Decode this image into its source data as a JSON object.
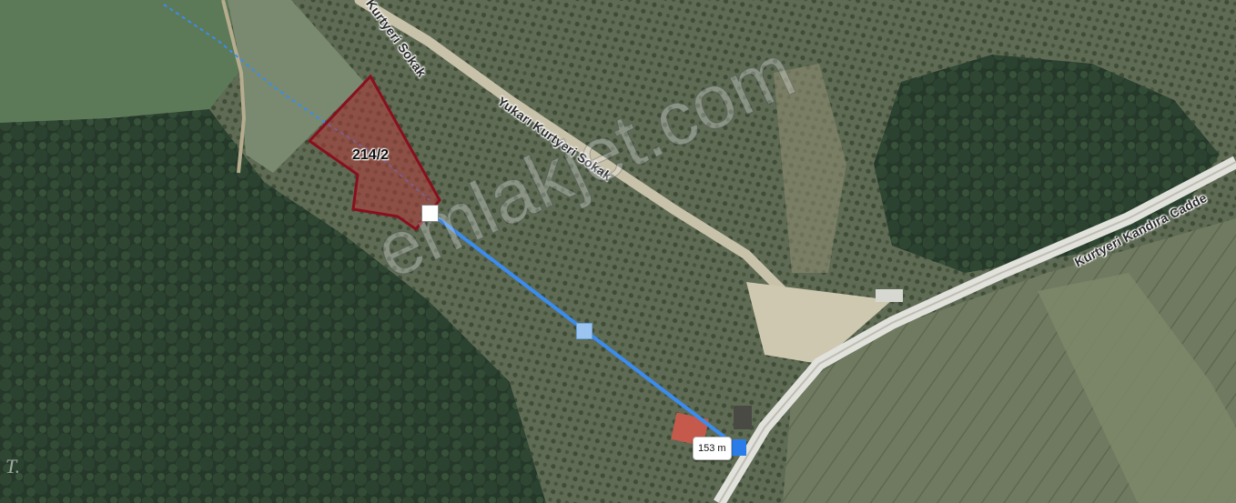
{
  "map": {
    "type": "satellite",
    "roads": [
      {
        "name": "Kurtyeri Sokak"
      },
      {
        "name": "Yukarı Kurtyeri Sokak"
      },
      {
        "name": "Kurtyeri Kandıra Cadde"
      }
    ],
    "parcel": {
      "label": "214/2",
      "fill_color": "#b03a3a",
      "border_color": "#8a0f1e"
    },
    "measurement": {
      "distance_label": "153 m",
      "line_color": "#3a8cf0"
    },
    "watermark": "emlakjet.com",
    "corner_mark": "T."
  }
}
